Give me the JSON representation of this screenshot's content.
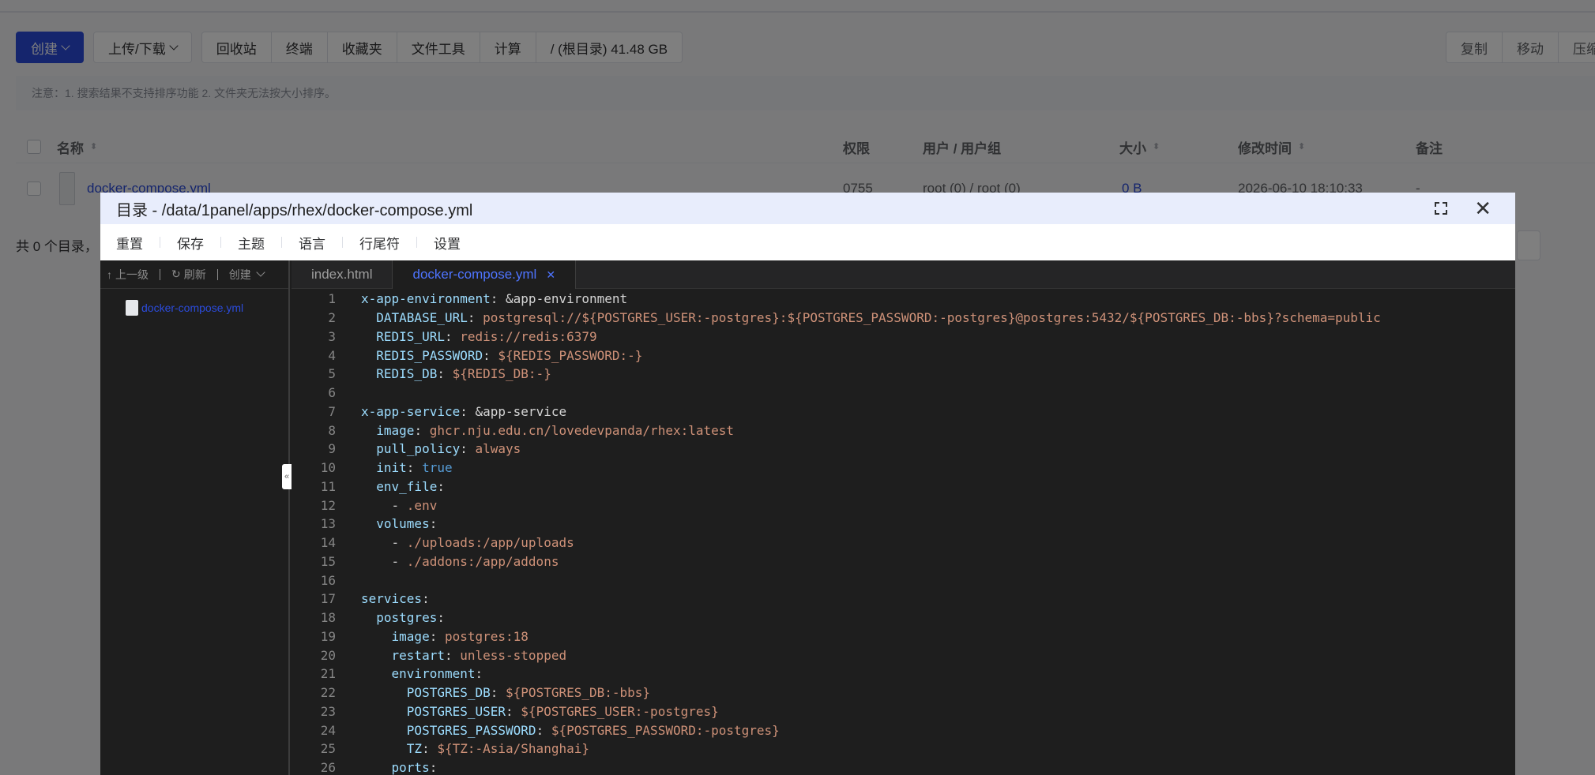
{
  "toolbar": {
    "create": "创建",
    "upload_download": "上传/下载",
    "group": [
      "回收站",
      "终端",
      "收藏夹",
      "文件工具",
      "计算"
    ],
    "disk": "/ (根目录) 41.48 GB",
    "right_group": [
      "复制",
      "移动",
      "压缩"
    ]
  },
  "notice": "注意：1. 搜索结果不支持排序功能 2. 文件夹无法按大小排序。",
  "table": {
    "headers": {
      "name": "名称",
      "permission": "权限",
      "user_group": "用户 / 用户组",
      "size": "大小",
      "modified": "修改时间",
      "remark": "备注"
    },
    "rows": [
      {
        "name": "docker-compose.yml",
        "permission": "0755",
        "user_group": "root (0) / root (0)",
        "size": "0 B",
        "modified": "2026-06-10 18:10:33",
        "remark": "-"
      }
    ]
  },
  "footer": {
    "summary": "共 0 个目录，"
  },
  "dialog": {
    "title": "目录 - /data/1panel/apps/rhex/docker-compose.yml",
    "menu": [
      "重置",
      "保存",
      "主题",
      "语言",
      "行尾符",
      "设置"
    ],
    "tree_bar": {
      "up": "上一级",
      "refresh": "刷新",
      "create": "创建"
    },
    "tree_file": "docker-compose.yml",
    "tabs": [
      {
        "label": "index.html",
        "active": false
      },
      {
        "label": "docker-compose.yml",
        "active": true
      }
    ],
    "icons": [
      "fullscreen-icon",
      "close-icon"
    ]
  },
  "code_lines": [
    {
      "n": "1",
      "indent": 0,
      "key": "x-app-environment",
      "val": "&app-environment",
      "type": "plain"
    },
    {
      "n": "2",
      "indent": 1,
      "key": "DATABASE_URL",
      "val": "postgresql://${POSTGRES_USER:-postgres}:${POSTGRES_PASSWORD:-postgres}@postgres:5432/${POSTGRES_DB:-bbs}?schema=public",
      "type": "str"
    },
    {
      "n": "3",
      "indent": 1,
      "key": "REDIS_URL",
      "val": "redis://redis:6379",
      "type": "str"
    },
    {
      "n": "4",
      "indent": 1,
      "key": "REDIS_PASSWORD",
      "val": "${REDIS_PASSWORD:-}",
      "type": "str"
    },
    {
      "n": "5",
      "indent": 1,
      "key": "REDIS_DB",
      "val": "${REDIS_DB:-}",
      "type": "str"
    },
    {
      "n": "6",
      "indent": 0,
      "key": "",
      "val": "",
      "type": "empty"
    },
    {
      "n": "7",
      "indent": 0,
      "key": "x-app-service",
      "val": "&app-service",
      "type": "plain"
    },
    {
      "n": "8",
      "indent": 1,
      "key": "image",
      "val": "ghcr.nju.edu.cn/lovedevpanda/rhex:latest",
      "type": "str"
    },
    {
      "n": "9",
      "indent": 1,
      "key": "pull_policy",
      "val": "always",
      "type": "str"
    },
    {
      "n": "10",
      "indent": 1,
      "key": "init",
      "val": "true",
      "type": "bool"
    },
    {
      "n": "11",
      "indent": 1,
      "key": "env_file",
      "val": "",
      "type": "key"
    },
    {
      "n": "12",
      "indent": 2,
      "key": "",
      "val": ".env",
      "type": "item"
    },
    {
      "n": "13",
      "indent": 1,
      "key": "volumes",
      "val": "",
      "type": "key"
    },
    {
      "n": "14",
      "indent": 2,
      "key": "",
      "val": "./uploads:/app/uploads",
      "type": "item"
    },
    {
      "n": "15",
      "indent": 2,
      "key": "",
      "val": "./addons:/app/addons",
      "type": "item"
    },
    {
      "n": "16",
      "indent": 0,
      "key": "",
      "val": "",
      "type": "empty"
    },
    {
      "n": "17",
      "indent": 0,
      "key": "services",
      "val": "",
      "type": "key"
    },
    {
      "n": "18",
      "indent": 1,
      "key": "postgres",
      "val": "",
      "type": "key"
    },
    {
      "n": "19",
      "indent": 2,
      "key": "image",
      "val": "postgres:18",
      "type": "str"
    },
    {
      "n": "20",
      "indent": 2,
      "key": "restart",
      "val": "unless-stopped",
      "type": "str"
    },
    {
      "n": "21",
      "indent": 2,
      "key": "environment",
      "val": "",
      "type": "key"
    },
    {
      "n": "22",
      "indent": 3,
      "key": "POSTGRES_DB",
      "val": "${POSTGRES_DB:-bbs}",
      "type": "str"
    },
    {
      "n": "23",
      "indent": 3,
      "key": "POSTGRES_USER",
      "val": "${POSTGRES_USER:-postgres}",
      "type": "str"
    },
    {
      "n": "24",
      "indent": 3,
      "key": "POSTGRES_PASSWORD",
      "val": "${POSTGRES_PASSWORD:-postgres}",
      "type": "str"
    },
    {
      "n": "25",
      "indent": 3,
      "key": "TZ",
      "val": "${TZ:-Asia/Shanghai}",
      "type": "str"
    },
    {
      "n": "26",
      "indent": 2,
      "key": "ports",
      "val": "",
      "type": "key"
    }
  ],
  "colors": {
    "primary": "#2b4bdb",
    "dialog_header": "#e8edfc",
    "editor_bg": "#1e1e1e",
    "key": "#9cdcfe",
    "string": "#ce9178",
    "keyword": "#569cd6",
    "active_tab": "#4e74ff"
  }
}
